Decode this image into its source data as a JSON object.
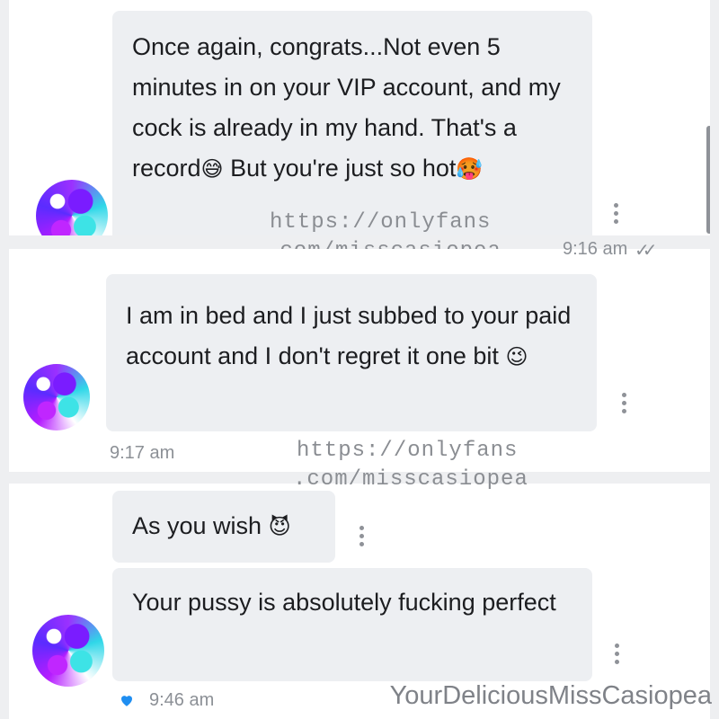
{
  "messages": [
    {
      "text": "Once again, congrats...Not even 5 minutes in on your VIP account, and my cock is already in my hand. That's a record",
      "emoji1": "😅",
      "text_after": " But you're just so hot",
      "emoji2": "🥵",
      "time": "9:16 am",
      "status": "read-double-check"
    },
    {
      "text": "I am in bed and I just subbed to your paid account and I don't regret it one bit ",
      "emoji": "😉",
      "time": "9:17 am"
    },
    {
      "text": "As you wish ",
      "emoji": "😈"
    },
    {
      "text": "Your pussy is absolutely fucking perfect",
      "time": "9:46 am",
      "liked": true
    }
  ],
  "watermark": {
    "line1": "https://onlyfans",
    "line2": ".com/misscasiopea",
    "footer": "YourDeliciousMissCasiopea"
  },
  "icons": {
    "avatar": "swirl-avatar-icon",
    "more": "kebab-menu-icon",
    "read": "double-check-icon",
    "like": "heart-icon"
  },
  "colors": {
    "bubble": "#edeff2",
    "background": "#eeeff1",
    "heart": "#1f8ef1",
    "muted": "#8c9096"
  }
}
